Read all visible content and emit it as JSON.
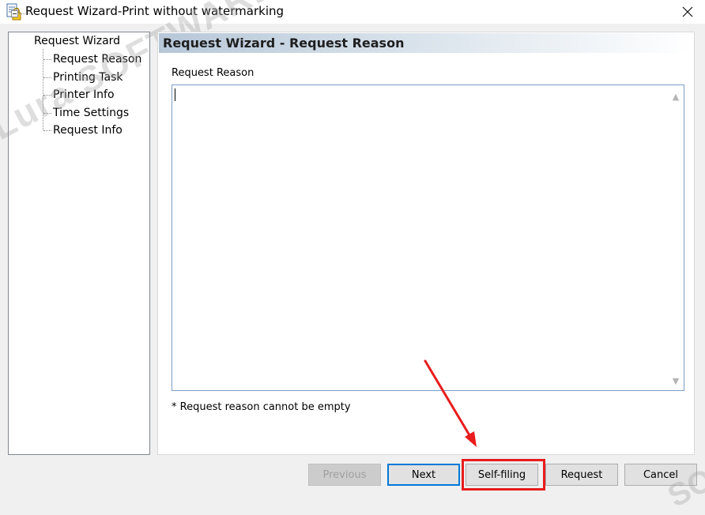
{
  "window": {
    "title": "Request Wizard-Print without watermarking",
    "close_icon": "close-icon",
    "app_icon": "document-lock-icon"
  },
  "watermark": {
    "text": "Lura SOFTWARE",
    "text2": "SOFTW"
  },
  "tree": {
    "root": "Request Wizard",
    "items": [
      {
        "label": "Request Reason",
        "selected": true
      },
      {
        "label": "Printing Task"
      },
      {
        "label": "Printer Info"
      },
      {
        "label": "Time Settings"
      },
      {
        "label": "Request Info"
      }
    ]
  },
  "page": {
    "header": "Request Wizard - Request Reason",
    "field_label": "Request Reason",
    "field_value": "",
    "note": "* Request reason cannot be empty"
  },
  "buttons": {
    "previous": "Previous",
    "next": "Next",
    "self_filing": "Self-filing",
    "request": "Request",
    "cancel": "Cancel"
  },
  "colors": {
    "annotation_red": "#e81c1c",
    "focus_blue": "#0078d7"
  }
}
